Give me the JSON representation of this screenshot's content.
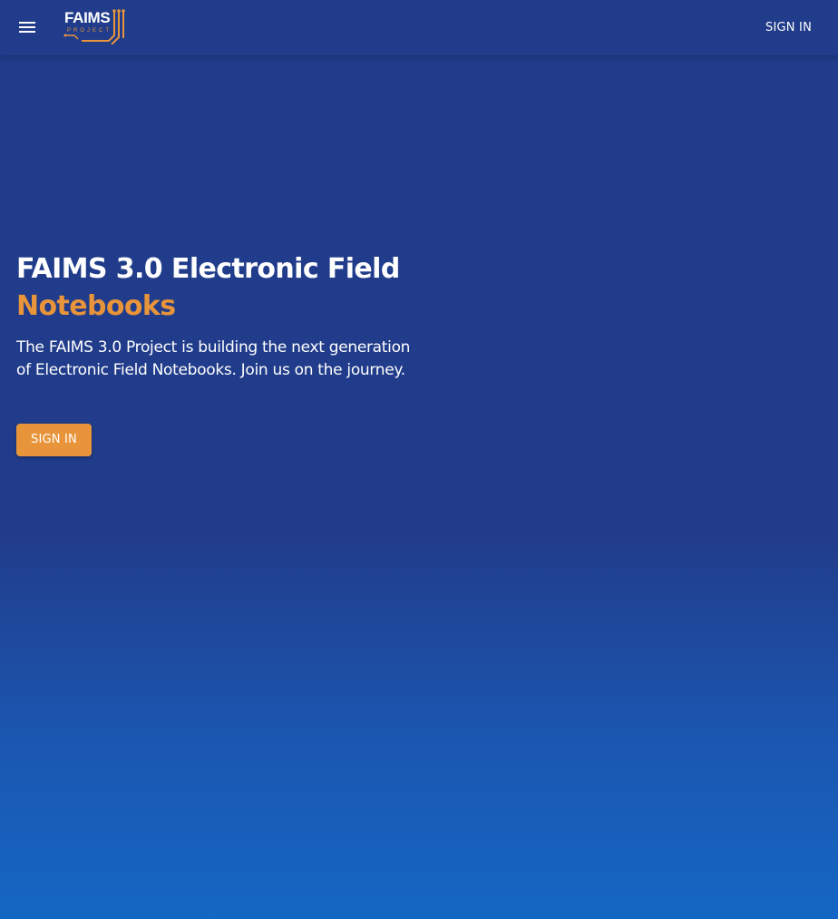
{
  "header": {
    "logo_text": "FAIMS",
    "logo_subtext": "PROJECT",
    "signin_label": "SIGN IN"
  },
  "hero": {
    "title": "FAIMS 3.0 Electronic Field",
    "title_accent": "Notebooks",
    "description": "The FAIMS 3.0 Project is building the next generation of Electronic Field Notebooks. Join us on the journey.",
    "button_label": "SIGN IN"
  },
  "icons": {
    "menu": "hamburger-menu-icon",
    "logo": "faims-logo"
  },
  "colors": {
    "primary": "#213c8a",
    "accent": "#e8943a",
    "gradient_bottom": "#1467c4",
    "text": "#ffffff"
  }
}
